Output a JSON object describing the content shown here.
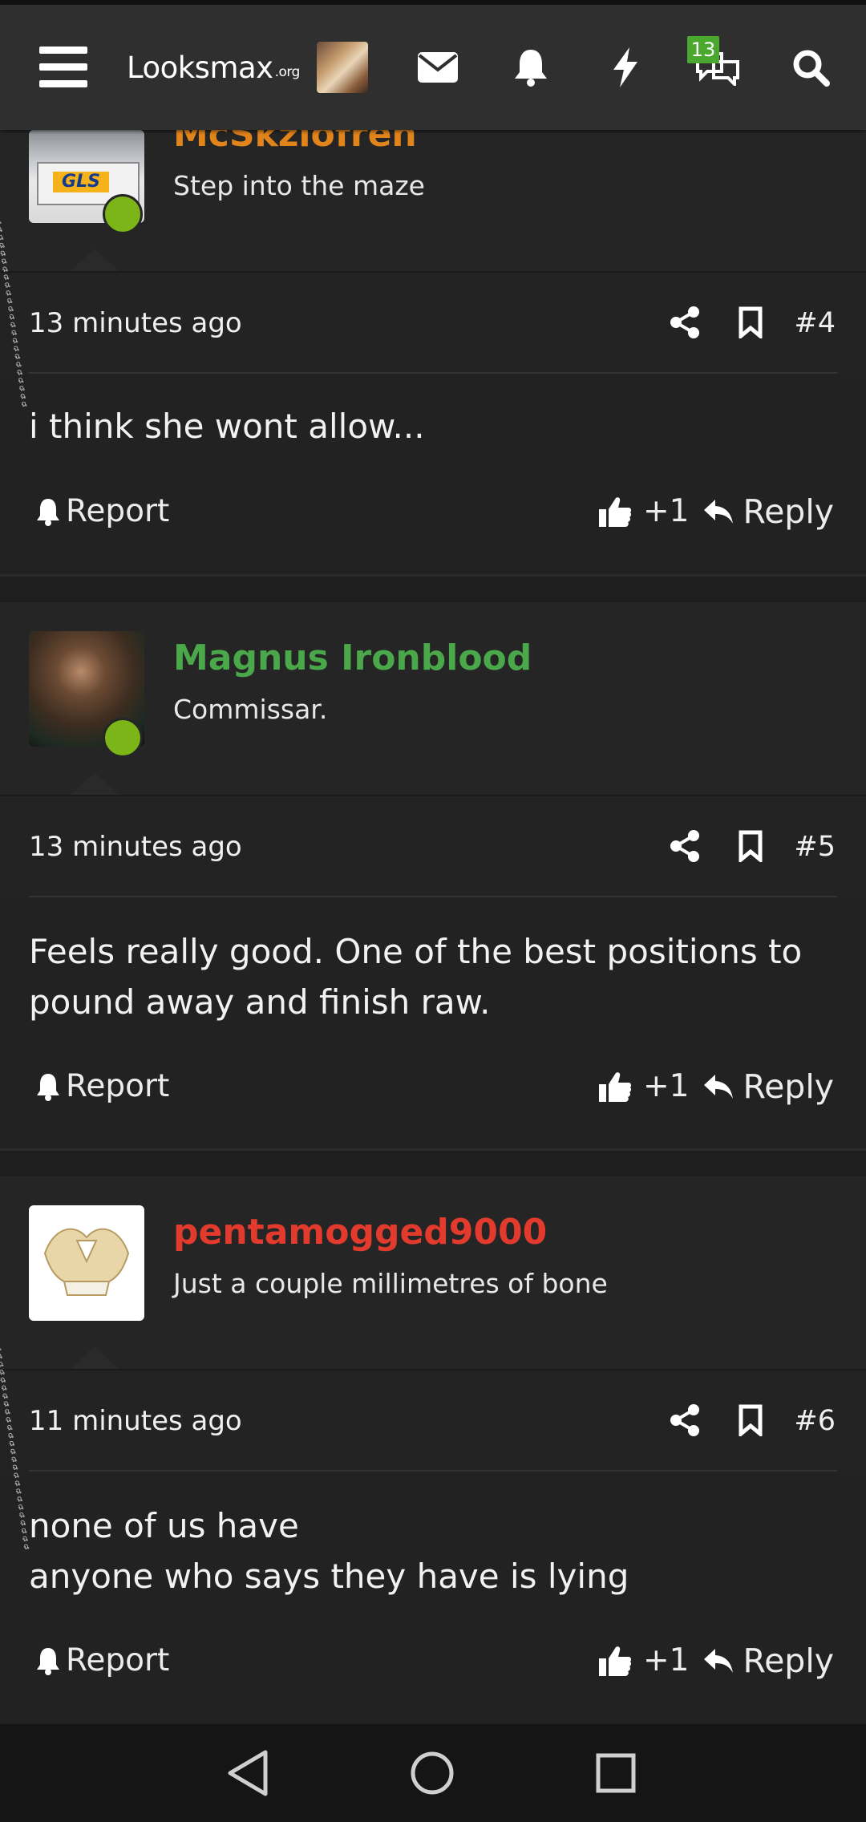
{
  "header": {
    "logo_main": "Looksmax",
    "logo_suffix": ".org",
    "conversations_badge": "13",
    "icons": [
      "menu-icon",
      "avatar",
      "mail-icon",
      "bell-icon",
      "bolt-icon",
      "chat-icon",
      "search-icon"
    ]
  },
  "posts": [
    {
      "username": "McSkziofren",
      "username_color": "#e0841b",
      "user_title": "Step into the maze",
      "time": "13 minutes ago",
      "number": "#4",
      "body": [
        "i think she wont allow..."
      ],
      "report_label": "Report",
      "like_count": "+1",
      "reply_label": "Reply"
    },
    {
      "username": "Magnus Ironblood",
      "username_color": "#4aa84a",
      "user_title": "Commissar.",
      "time": "13 minutes ago",
      "number": "#5",
      "body": [
        "Feels really good. One of the best positions to",
        "pound away and finish raw."
      ],
      "report_label": "Report",
      "like_count": "+1",
      "reply_label": "Reply"
    },
    {
      "username": "pentamogged9000",
      "username_color": "#e23b2e",
      "user_title": "Just a couple millimetres of bone",
      "time": "11 minutes ago",
      "number": "#6",
      "body": [
        "none of us have",
        "anyone who says they have is lying"
      ],
      "report_label": "Report",
      "like_count": "+1",
      "reply_label": "Reply"
    }
  ],
  "colors": {
    "background": "#222222",
    "header": "#2f2f2f",
    "online": "#7cb518",
    "badge": "#4aa82e"
  }
}
